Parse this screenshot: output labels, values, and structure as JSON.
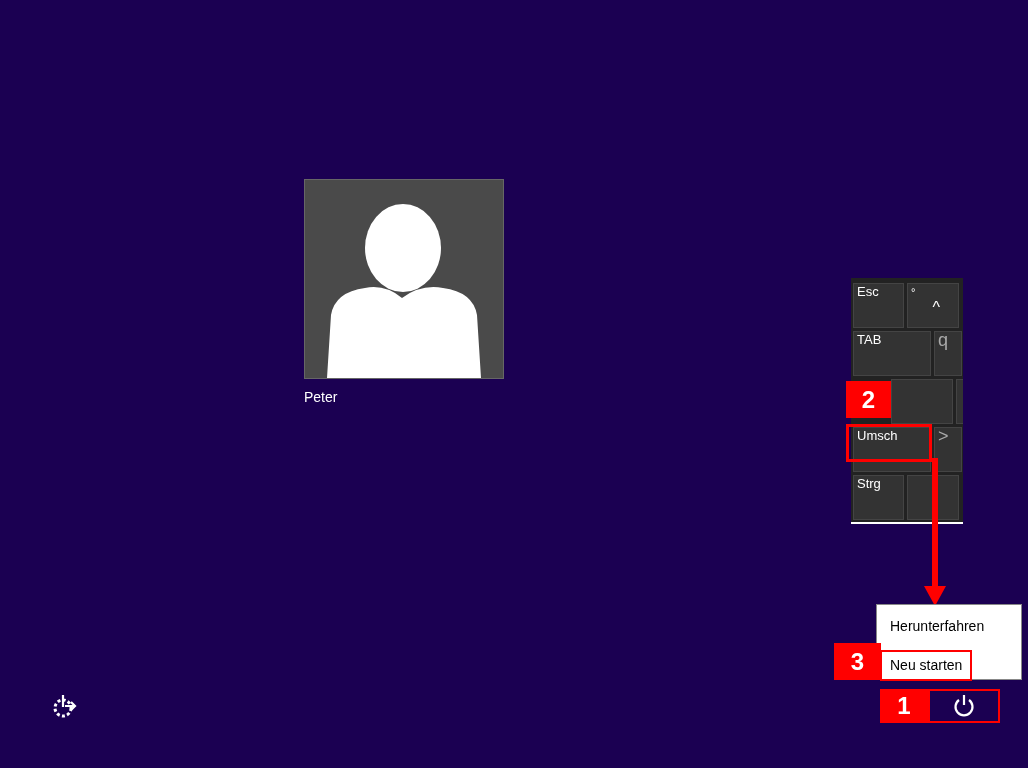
{
  "user": {
    "name": "Peter"
  },
  "keyboard": {
    "rows": [
      [
        {
          "label": "Esc",
          "kind": "wide"
        },
        {
          "label": "^",
          "shift": "°",
          "kind": "narrow"
        }
      ],
      [
        {
          "label": "TAB",
          "kind": "wider"
        },
        {
          "label": "q",
          "kind": "cut"
        }
      ],
      [
        {
          "kind": "widest"
        },
        {
          "kind": "cut"
        }
      ],
      [
        {
          "label": "Umsch",
          "kind": "wider"
        },
        {
          "label": ">",
          "kind": "cut"
        }
      ],
      [
        {
          "label": "Strg",
          "kind": "wide"
        },
        {
          "kind": "narrow"
        }
      ]
    ]
  },
  "power_menu": {
    "items": [
      {
        "label": "Herunterfahren",
        "selected": false
      },
      {
        "label": "Neu starten",
        "selected": true
      }
    ]
  },
  "annotations": [
    {
      "number": "1",
      "kind": "power"
    },
    {
      "number": "2",
      "kind": "key"
    },
    {
      "number": "3",
      "kind": "menu"
    }
  ]
}
